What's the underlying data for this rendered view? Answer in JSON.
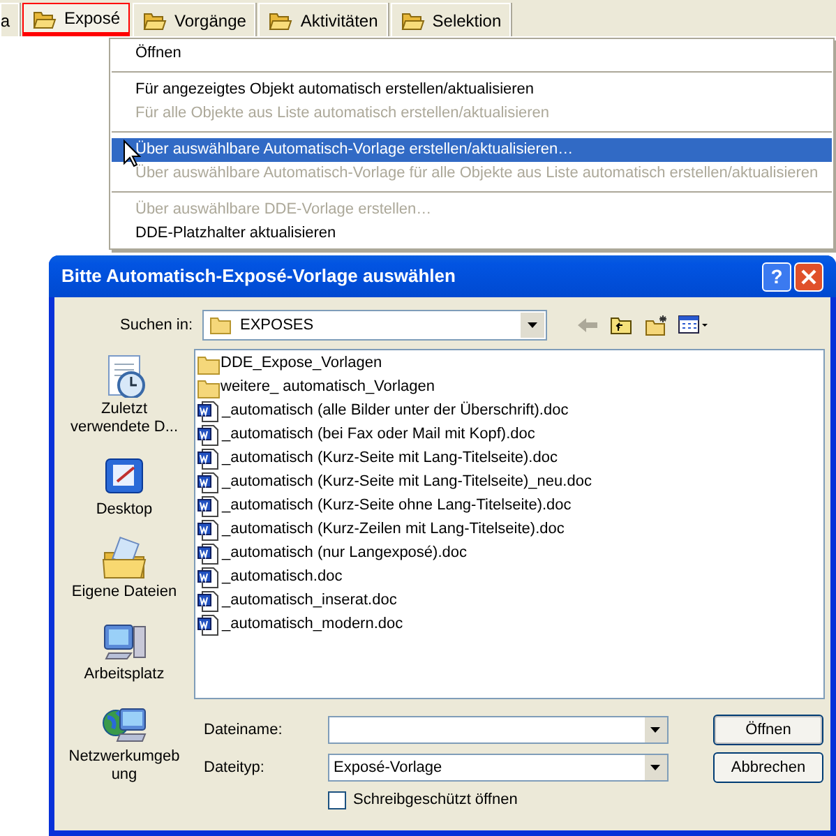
{
  "tabs": [
    {
      "label": "a",
      "selected": false,
      "highlighted": false
    },
    {
      "label": "Exposé",
      "selected": true,
      "highlighted": true
    },
    {
      "label": "Vorgänge",
      "selected": false,
      "highlighted": false
    },
    {
      "label": "Aktivitäten",
      "selected": false,
      "highlighted": false
    },
    {
      "label": "Selektion",
      "selected": false,
      "highlighted": false
    }
  ],
  "menu": {
    "items": [
      {
        "kind": "item",
        "label": "Öffnen",
        "disabled": false,
        "selected": false
      },
      {
        "kind": "separator"
      },
      {
        "kind": "item",
        "label": "Für angezeigtes Objekt automatisch erstellen/aktualisieren",
        "disabled": false,
        "selected": false
      },
      {
        "kind": "item",
        "label": "Für alle Objekte aus Liste automatisch erstellen/aktualisieren",
        "disabled": true,
        "selected": false
      },
      {
        "kind": "separator"
      },
      {
        "kind": "item",
        "label": "Über auswählbare Automatisch-Vorlage erstellen/aktualisieren…",
        "disabled": false,
        "selected": true
      },
      {
        "kind": "item",
        "label": "Über auswählbare Automatisch-Vorlage für alle Objekte aus Liste automatisch erstellen/aktualisieren",
        "disabled": true,
        "selected": false
      },
      {
        "kind": "separator"
      },
      {
        "kind": "item",
        "label": "Über auswählbare DDE-Vorlage erstellen…",
        "disabled": true,
        "selected": false
      },
      {
        "kind": "item",
        "label": "DDE-Platzhalter aktualisieren",
        "disabled": false,
        "selected": false
      }
    ]
  },
  "dialog": {
    "title": "Bitte Automatisch-Exposé-Vorlage auswählen",
    "help_button": "?",
    "look_in": {
      "label": "Suchen in:",
      "value": "EXPOSES"
    },
    "places": [
      {
        "kind": "recent",
        "label": "Zuletzt verwendete D..."
      },
      {
        "kind": "desktop",
        "label": "Desktop"
      },
      {
        "kind": "documents",
        "label": "Eigene Dateien"
      },
      {
        "kind": "computer",
        "label": "Arbeitsplatz"
      },
      {
        "kind": "network",
        "label": "Netzwerkumgebung"
      }
    ],
    "files": [
      {
        "kind": "folder",
        "name": "DDE_Expose_Vorlagen"
      },
      {
        "kind": "folder",
        "name": "weitere_ automatisch_Vorlagen"
      },
      {
        "kind": "doc",
        "name": "_automatisch (alle Bilder unter der Überschrift).doc"
      },
      {
        "kind": "doc",
        "name": "_automatisch (bei Fax oder Mail mit Kopf).doc"
      },
      {
        "kind": "doc",
        "name": "_automatisch (Kurz-Seite mit Lang-Titelseite).doc"
      },
      {
        "kind": "doc",
        "name": "_automatisch (Kurz-Seite mit Lang-Titelseite)_neu.doc"
      },
      {
        "kind": "doc",
        "name": "_automatisch (Kurz-Seite ohne Lang-Titelseite).doc"
      },
      {
        "kind": "doc",
        "name": "_automatisch (Kurz-Zeilen mit Lang-Titelseite).doc"
      },
      {
        "kind": "doc",
        "name": "_automatisch (nur Langexposé).doc"
      },
      {
        "kind": "doc",
        "name": "_automatisch.doc"
      },
      {
        "kind": "doc",
        "name": "_automatisch_inserat.doc"
      },
      {
        "kind": "doc",
        "name": "_automatisch_modern.doc"
      }
    ],
    "file_name": {
      "label": "Dateiname:"
    },
    "file_type": {
      "label": "Dateityp:",
      "value": "Exposé-Vorlage"
    },
    "read_only": {
      "label": "Schreibgeschützt öffnen",
      "checked": false
    },
    "buttons": [
      "Öffnen",
      "Abbrechen"
    ]
  }
}
